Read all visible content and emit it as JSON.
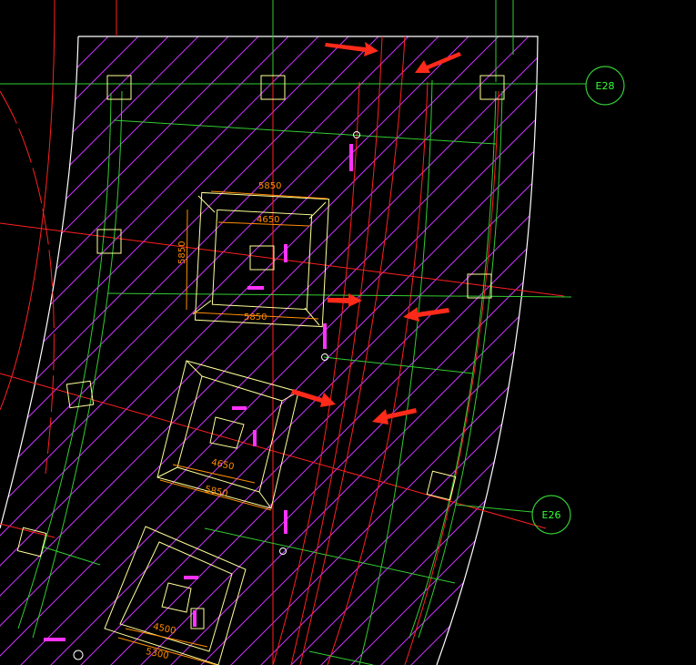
{
  "grid_bubbles": [
    {
      "id": "bubble-e28",
      "label": "E28"
    },
    {
      "id": "bubble-e26",
      "label": "E26"
    }
  ],
  "pile_caps": [
    {
      "id": "cap-1",
      "outer_dim_top": "5850",
      "inner_dim_top": "4650",
      "side_dim": "5850",
      "bottom_dim": "5850"
    },
    {
      "id": "cap-2",
      "inner_dim_bottom": "4650",
      "outer_dim_bottom": "5850"
    },
    {
      "id": "cap-3",
      "inner_dim_bottom": "4500",
      "outer_dim_bottom": "5300"
    }
  ],
  "colors": {
    "background": "#000000",
    "hatch": "#cc33ff",
    "outline": "#ffffff",
    "grid_line": "#33cc33",
    "axis_line": "#ff2020",
    "column": "#ffff99",
    "dimension": "#ff8c00",
    "arrow": "#ff2a1a"
  }
}
